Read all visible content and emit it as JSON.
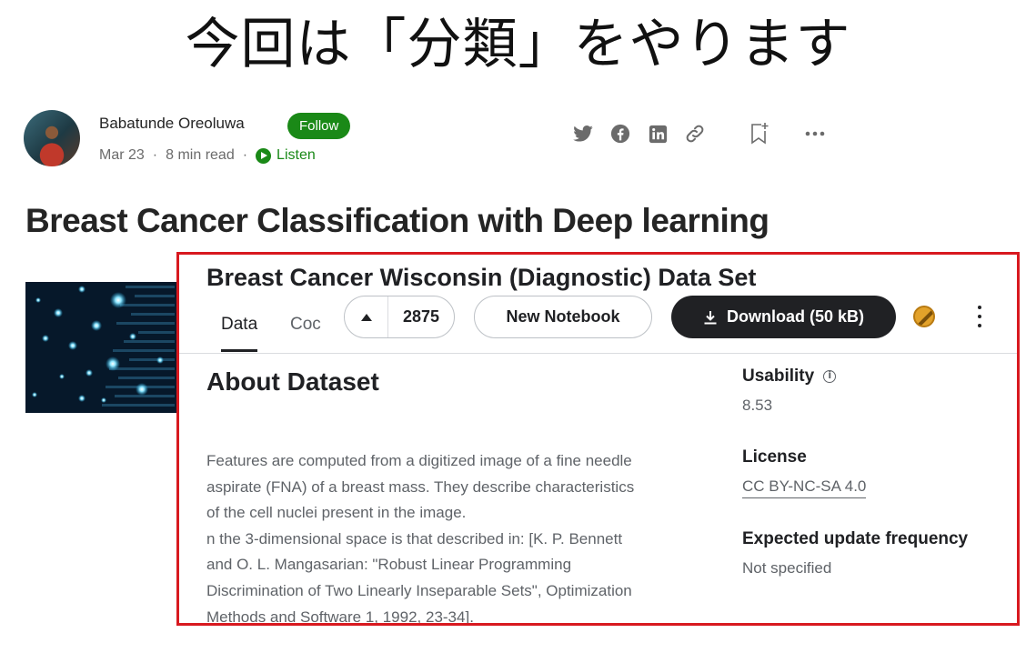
{
  "slide": {
    "title": "今回は「分類」をやります"
  },
  "author": {
    "name": "Babatunde Oreoluwa",
    "follow_label": "Follow",
    "date": "Mar 23",
    "read_time": "8 min read",
    "separator": "·",
    "listen_label": "Listen"
  },
  "share_icons": [
    "twitter-icon",
    "facebook-icon",
    "linkedin-icon",
    "link-icon",
    "bookmark-add-icon",
    "more-icon"
  ],
  "article": {
    "title": "Breast Cancer Classification with Deep learning"
  },
  "dataset": {
    "title": "Breast Cancer Wisconsin (Diagnostic) Data Set",
    "tabs": [
      "Data",
      "Coc"
    ],
    "vote_count": "2875",
    "new_notebook_label": "New Notebook",
    "download_label": "Download (50 kB)",
    "about_title": "About Dataset",
    "about_lines": [
      "Features are computed from a digitized image of a fine needle",
      "aspirate (FNA) of a breast mass. They describe characteristics",
      "of the cell nuclei present in the image.",
      "n the 3-dimensional space is that described in: [K. P. Bennett",
      "and O. L. Mangasarian: \"Robust Linear Programming",
      "Discrimination of Two Linearly Inseparable Sets\", Optimization",
      "Methods and Software 1, 1992, 23-34]."
    ],
    "usability_label": "Usability",
    "usability_value": "8.53",
    "license_label": "License",
    "license_value": "CC BY-NC-SA 4.0",
    "update_label": "Expected update frequency",
    "update_value": "Not specified"
  },
  "colors": {
    "follow_green": "#1a8917",
    "highlight_red": "#d8191f",
    "download_dark": "#202124",
    "medal_gold": "#e3a22a"
  }
}
